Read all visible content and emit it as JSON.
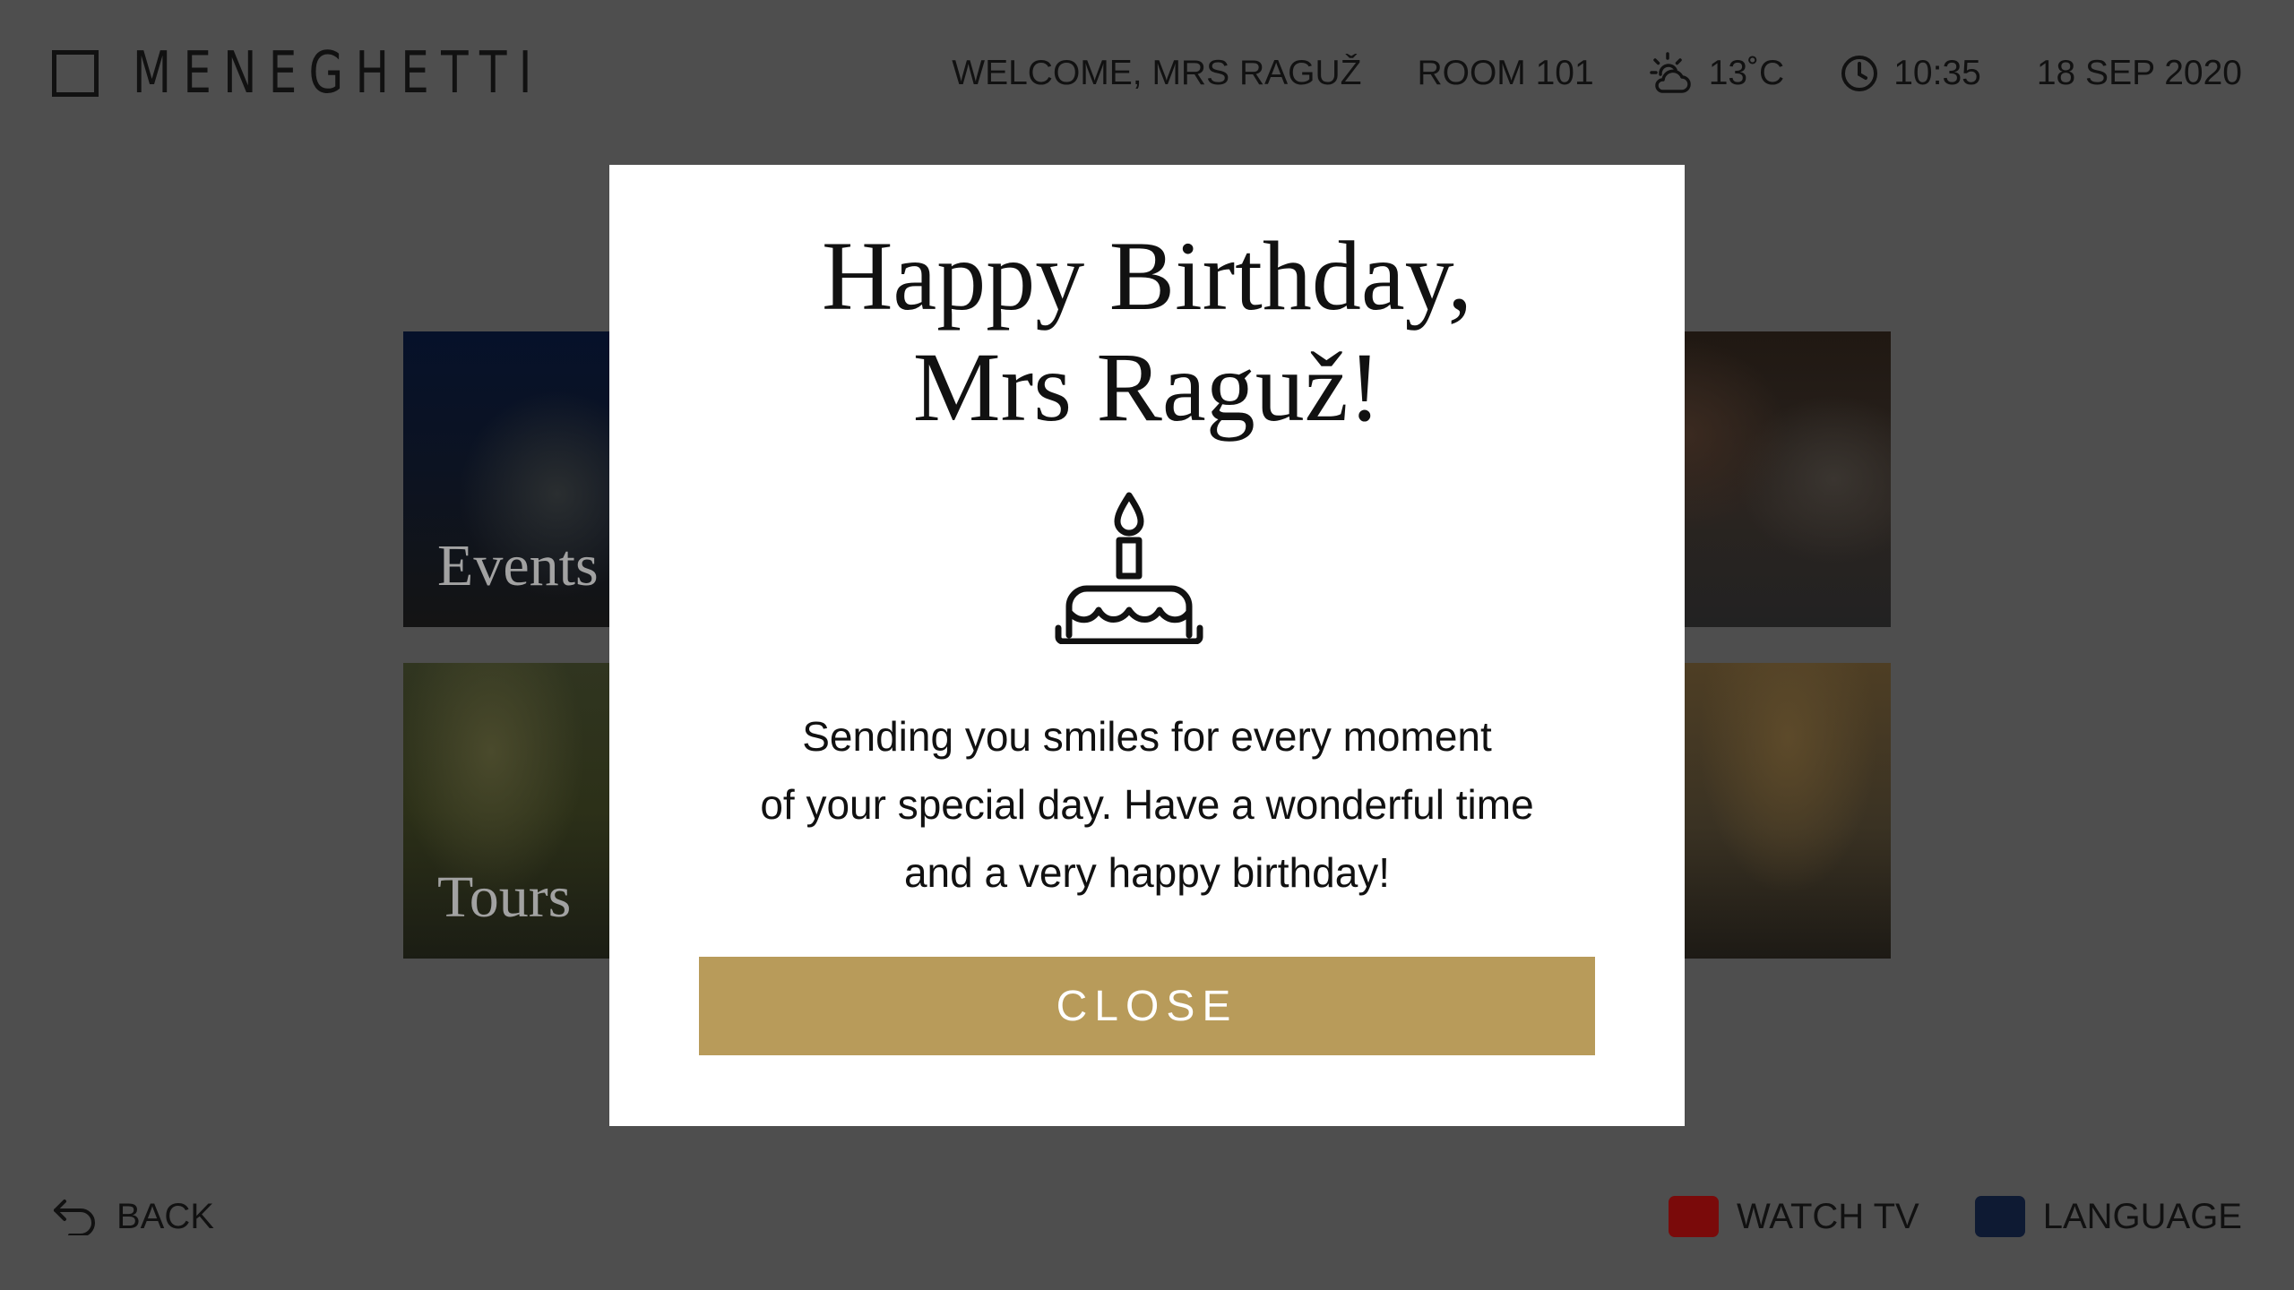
{
  "brand": {
    "name": "MENEGHETTI",
    "logo_icon": "square-outline-icon"
  },
  "status_bar": {
    "welcome": "WELCOME, MRS RAGUŽ",
    "room": "ROOM 101",
    "weather": {
      "icon": "sun-cloud-icon",
      "temperature": "13˚C"
    },
    "time": {
      "icon": "clock-icon",
      "value": "10:35"
    },
    "date": "18 SEP 2020"
  },
  "tiles": [
    {
      "label": "Events"
    },
    {
      "label": ""
    },
    {
      "label": "Tours"
    },
    {
      "label": ""
    }
  ],
  "modal": {
    "title_line1": "Happy Birthday,",
    "title_line2": "Mrs Raguž!",
    "icon": "birthday-cake-icon",
    "message_line1": "Sending you smiles for every moment",
    "message_line2": "of your special day. Have a wonderful time",
    "message_line3": "and a very happy birthday!",
    "close_label": "CLOSE"
  },
  "footer": {
    "back": {
      "icon": "back-arrow-icon",
      "label": "BACK"
    },
    "watch_tv": {
      "label": "WATCH TV",
      "color": "#7a0a0a"
    },
    "language": {
      "label": "LANGUAGE",
      "color": "#0e1a33"
    }
  },
  "colors": {
    "overlay_background": "#4e4e4e",
    "modal_background": "#ffffff",
    "accent_gold": "#b89b5a",
    "text": "#111111"
  }
}
